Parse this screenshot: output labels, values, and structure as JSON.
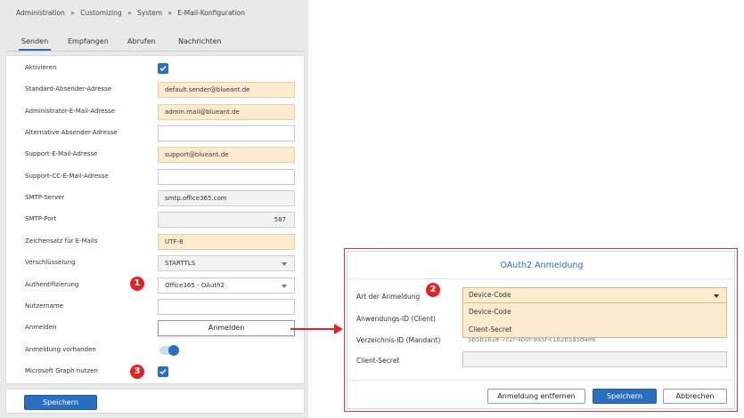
{
  "breadcrumb": {
    "items": [
      "Administration",
      "Customizing",
      "System",
      "E-Mail-Konfiguration"
    ],
    "separator": "»"
  },
  "tabs": [
    {
      "label": "Senden",
      "active": true
    },
    {
      "label": "Empfangen",
      "active": false
    },
    {
      "label": "Abrufen",
      "active": false
    },
    {
      "label": "Nachrichten",
      "active": false
    }
  ],
  "form": {
    "aktivieren": {
      "label": "Aktivieren",
      "checked": true
    },
    "standard_absender": {
      "label": "Standard-Absender-Adresse",
      "value": "default.sender@blueant.de"
    },
    "admin_mail": {
      "label": "Administrator-E-Mail-Adresse",
      "value": "admin.mail@blueant.de"
    },
    "alt_absender": {
      "label": "Alternative Absender-Adresse",
      "value": ""
    },
    "support_mail": {
      "label": "Support-E-Mail-Adresse",
      "value": "support@blueant.de"
    },
    "support_cc": {
      "label": "Support-CC-E-Mail-Adresse",
      "value": ""
    },
    "smtp_server": {
      "label": "SMTP-Server",
      "value": "smtp.office365.com"
    },
    "smtp_port": {
      "label": "SMTP-Port",
      "value": "587"
    },
    "zeichensatz": {
      "label": "Zeichensatz für E-Mails",
      "value": "UTF-8"
    },
    "verschluesselung": {
      "label": "Verschlüsselung",
      "value": "STARTTLS"
    },
    "authentifizierung": {
      "label": "Authentifizierung",
      "value": "Office365 - OAuth2"
    },
    "nutzername": {
      "label": "Nutzername",
      "value": ""
    },
    "anmelden": {
      "label": "Anmelden",
      "button_label": "Anmelden"
    },
    "anmeldung_vorhanden": {
      "label": "Anmeldung vorhanden",
      "on": true
    },
    "microsoft_graph": {
      "label": "Microsoft Graph nutzen",
      "checked": true
    }
  },
  "footer": {
    "save_label": "Speichern"
  },
  "badges": {
    "one": "1",
    "two": "2",
    "three": "3"
  },
  "dialog": {
    "title": "OAuth2 Anmeldung",
    "art_label": "Art der Anmeldung",
    "art_value": "Device-Code",
    "options": [
      "Device-Code",
      "Client-Secret"
    ],
    "anwendungs_label": "Anwendungs-ID (Client)",
    "verzeichnis_label": "Verzeichnis-ID (Mandant)",
    "verzeichnis_value": "5b5b1b2e-7c2f-4b0f-9a5f-c1b2b5a5d4e6",
    "client_secret_label": "Client-Secret",
    "client_secret_value": "",
    "btn_remove": "Anmeldung entfernen",
    "btn_save": "Speichern",
    "btn_cancel": "Abbrechen"
  },
  "colors": {
    "accent": "#2a6fbf",
    "highlight_field": "#fdebcf",
    "callout_red": "#e02424"
  }
}
